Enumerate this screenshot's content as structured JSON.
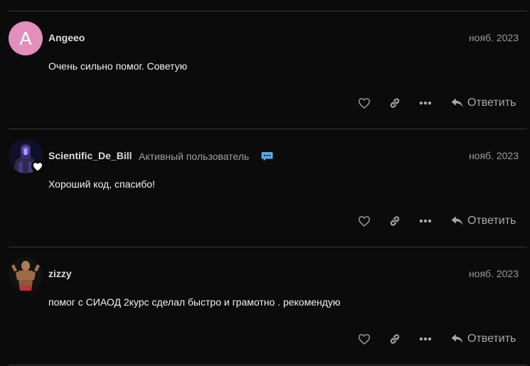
{
  "posts": [
    {
      "username": "Angeeo",
      "avatar_letter": "A",
      "avatar_color": "#e38fbd",
      "user_title": "",
      "date": "нояб. 2023",
      "text": "Очень сильно помог. Советую",
      "reply_label": "Ответить"
    },
    {
      "username": "Scientific_De_Bill",
      "user_title": "Активный пользователь",
      "badge_icon": "chat-bubble-icon",
      "avatar_flair": "heart-icon",
      "date": "нояб. 2023",
      "text": "Хороший код, спасибо!",
      "reply_label": "Ответить"
    },
    {
      "username": "zizzy",
      "user_title": "",
      "date": "нояб. 2023",
      "text": "помог с СИАОД 2курс сделал быстро и грамотно . рекомендую",
      "reply_label": "Ответить"
    }
  ],
  "icons": {
    "like": "heart-outline-icon",
    "link": "link-icon",
    "more": "ellipsis-icon",
    "reply": "reply-arrow-icon"
  },
  "colors": {
    "background": "#0b0b0b",
    "divider": "#3a3a3a",
    "chat_badge": "#5aa7e6"
  }
}
